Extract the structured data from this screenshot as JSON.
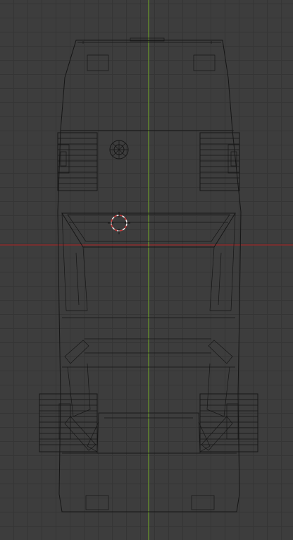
{
  "viewport": {
    "view": "top-orthographic",
    "colors": {
      "background": "#3d3d3d",
      "grid": "#353535",
      "x_axis": "#9a2a2a",
      "y_axis": "#6a9a2a",
      "wireframe": "#161616",
      "cursor_red": "#c33b3b",
      "cursor_white": "#e6e6e6"
    },
    "object": {
      "name_icon": "car-wireframe",
      "parts": [
        "body",
        "roof-top",
        "windshield",
        "front-wheel-left",
        "front-wheel-right",
        "rear-wheel-left",
        "rear-wheel-right",
        "bumper-rear"
      ]
    },
    "cursor_icon": "3d-cursor-icon",
    "origin_icon": "object-origin-icon"
  }
}
